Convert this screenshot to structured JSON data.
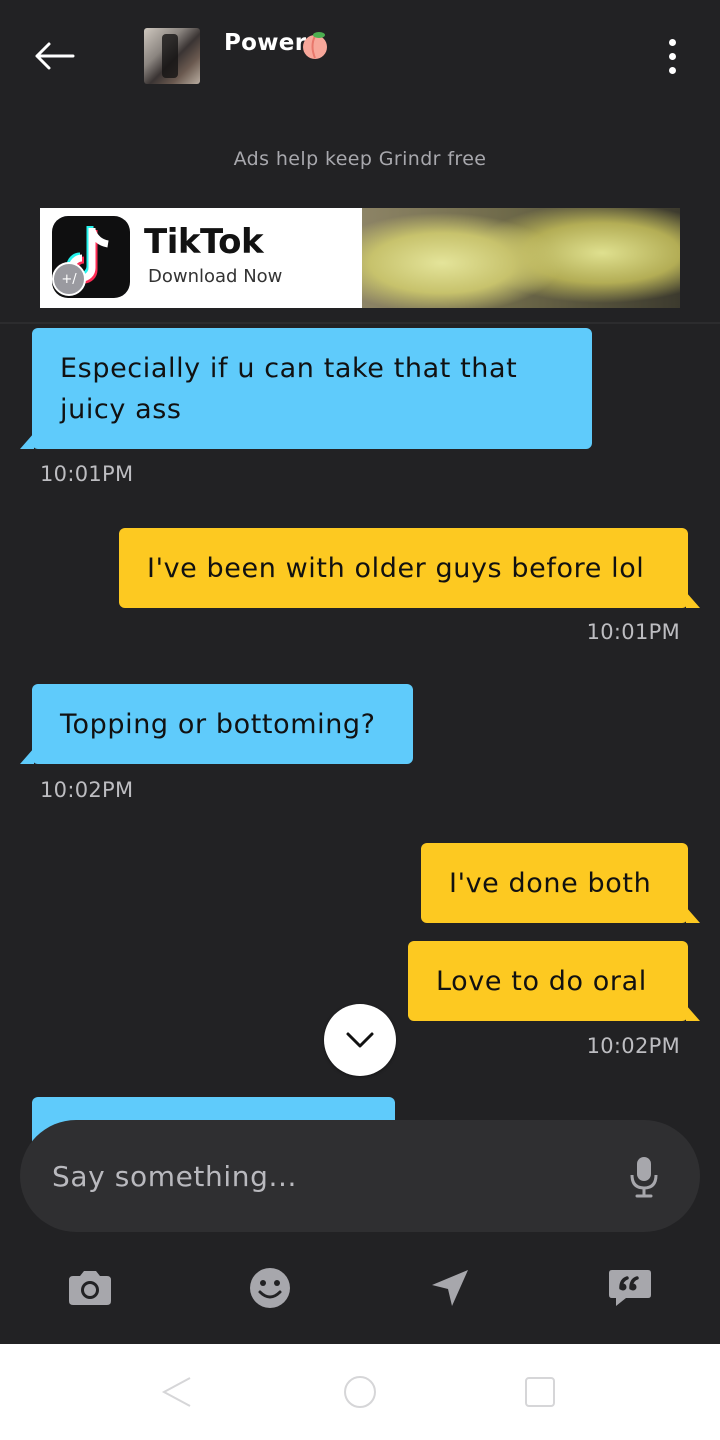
{
  "header": {
    "back_icon": "arrow-left-icon",
    "name": "Power",
    "name_emoji": "peach-emoji",
    "menu_icon": "more-vertical-icon"
  },
  "ad": {
    "caption": "Ads help keep Grindr free",
    "brand": "TikTok",
    "cta": "Download Now",
    "badge": "+/"
  },
  "messages": [
    {
      "direction": "incoming",
      "lines": [
        "Especially if u can take that that",
        "juicy ass"
      ],
      "time": "10:01PM"
    },
    {
      "direction": "outgoing",
      "lines": [
        "I've been with older guys before lol"
      ],
      "time": "10:01PM"
    },
    {
      "direction": "incoming",
      "lines": [
        "Topping or bottoming?"
      ],
      "time": "10:02PM"
    },
    {
      "direction": "outgoing",
      "lines": [
        "I've done both"
      ],
      "time": ""
    },
    {
      "direction": "outgoing",
      "lines": [
        "Love to do oral"
      ],
      "time": "10:02PM"
    }
  ],
  "composer": {
    "placeholder": "Say something...",
    "value": ""
  },
  "toolbar": [
    "camera-icon",
    "emoji-icon",
    "location-arrow-icon",
    "saved-phrases-icon"
  ],
  "colors": {
    "background": "#222224",
    "incoming_bubble": "#5fcbfb",
    "outgoing_bubble": "#fdc921",
    "composer": "#2f2f31"
  }
}
